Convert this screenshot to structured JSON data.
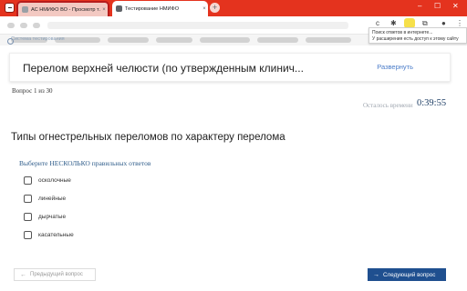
{
  "browser": {
    "tabs": [
      {
        "title": "АС НМИФО ВО - Просмотр т…",
        "active": false
      },
      {
        "title": "Тестирование НМИФО",
        "active": true
      }
    ],
    "new_tab": "+",
    "window_controls": {
      "minimize": "–",
      "maximize": "☐",
      "close": "✕"
    },
    "tooltip": {
      "line1": "Поиск ответов в интернете...",
      "line2": "У расширения есть доступ к этому сайту"
    },
    "colors": {
      "tabbar": "#e4331e"
    }
  },
  "site": {
    "subtitle": "Система тестирования"
  },
  "topic": {
    "title": "Перелом верхней челюсти (по утвержденным клинич...",
    "expand_label": "Развернуть"
  },
  "progress": {
    "counter": "Вопрос 1 из 30",
    "timer_label": "Осталось времени",
    "timer_value": "0:39:55"
  },
  "question": {
    "text": "Типы огнестрельных переломов по характеру перелома",
    "instruction": "Выберите НЕСКОЛЬКО правильных ответов",
    "options": [
      "осколочные",
      "линейные",
      "дырчатые",
      "касательные"
    ]
  },
  "nav": {
    "prev_label": "Предыдущий вопрос",
    "next_label": "Следующий вопрос"
  },
  "colors": {
    "accent": "#1f4f8f",
    "link": "#4a7cc9",
    "timer": "#1f3f66"
  }
}
